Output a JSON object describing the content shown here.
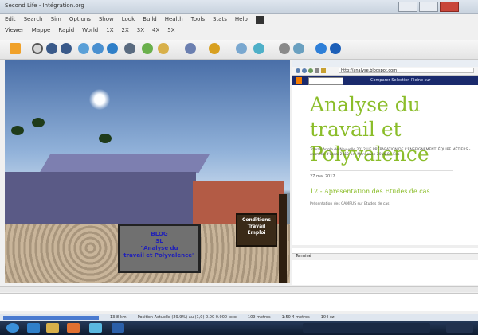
{
  "window": {
    "title": "Second Life - Intégration.org",
    "menu": [
      "Edit",
      "Search",
      "Sim",
      "Options",
      "Show",
      "Look",
      "Build",
      "Health",
      "Tools",
      "Stats",
      "Help"
    ],
    "menu2": [
      "Viewer",
      "Mappe",
      "Rapid",
      "World",
      "1X",
      "2X",
      "3X",
      "4X",
      "5X"
    ]
  },
  "toolbar": {
    "icons": [
      "orange-folder-icon",
      "home-icon",
      "binoculars-icon",
      "binoculars2-icon",
      "blue-cluster-icon",
      "globe-icon",
      "chart-icon",
      "wrench-icon",
      "person-icon",
      "pet-icon",
      "group-icon",
      "help-icon"
    ]
  },
  "scene": {
    "signboard_lines": [
      "BLOG",
      "SL ",
      "\"Analyse du",
      "travail et Polyvalence\""
    ],
    "sign2_lines": [
      "Conditions",
      "Travail",
      "Emploi"
    ]
  },
  "browser": {
    "url": "http://analyse.blogspot.com",
    "nav_links": "Comparer  Selection  Pleine sur",
    "blog_title": "Analyse du travail et\nPolyvalence",
    "blog_desc": "Travail Angle de Nouvelle 2012 UE PRÉPARATION DE L'ENSEIGNEMENT. ÉQUIPE MÉTIERS - Avancée d'Essai 2012 1er Mars mise 2014-0 - Exa",
    "date": "27 mai 2012",
    "post_title": "12 - Apresentation des Etudes de cas",
    "post_meta": "Présentation des CAMPUS sur Etudes de cas",
    "status": "Terminé"
  },
  "statusbar": {
    "progress": 1,
    "texts": [
      "13:8 km",
      "Position Actuelle (29.9%) au (1,0) 0.00 0.000 loco",
      "109 metres",
      "1:50 4 metres",
      "104 oz"
    ]
  },
  "taskbar": {
    "icons": [
      "start-icon",
      "ie-icon",
      "folder-icon",
      "media-icon",
      "sl-icon",
      "word-icon"
    ]
  }
}
